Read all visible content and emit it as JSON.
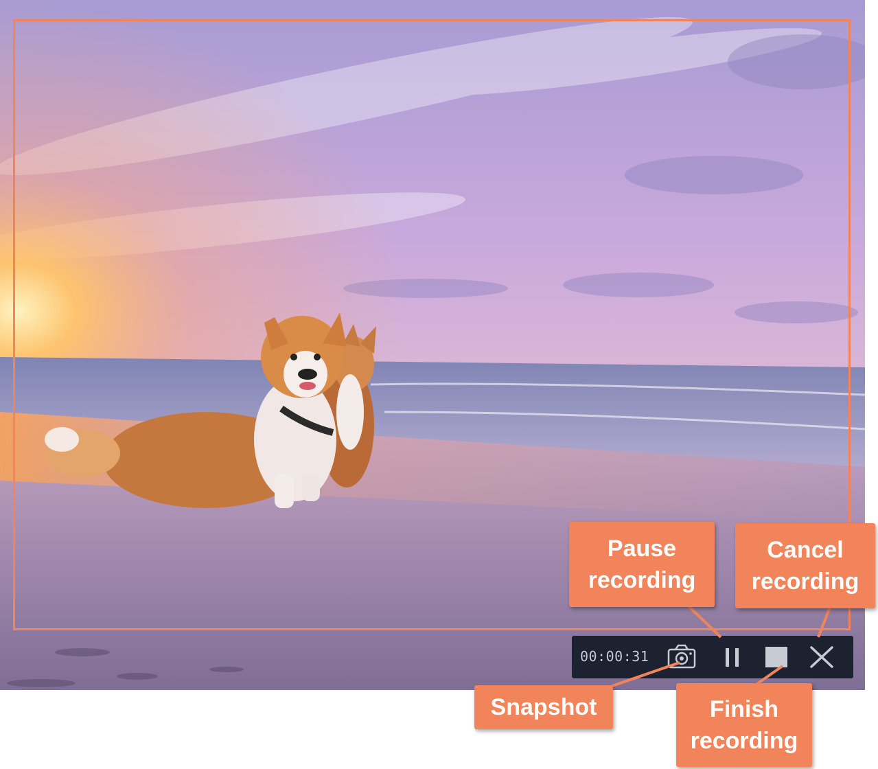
{
  "recorder": {
    "timer": "00:00:31"
  },
  "buttons": {
    "snapshot_icon": "camera-icon",
    "pause_icon": "pause-icon",
    "stop_icon": "stop-square-icon",
    "cancel_icon": "close-x-icon"
  },
  "callouts": {
    "pause": [
      "Pause",
      "recording"
    ],
    "cancel": [
      "Cancel",
      "recording"
    ],
    "snapshot": [
      "Snapshot"
    ],
    "finish": [
      "Finish",
      "recording"
    ]
  },
  "colors": {
    "accent": "#f1845a",
    "toolbar_bg": "#1c2230",
    "toolbar_icon": "#c7cbd3"
  }
}
